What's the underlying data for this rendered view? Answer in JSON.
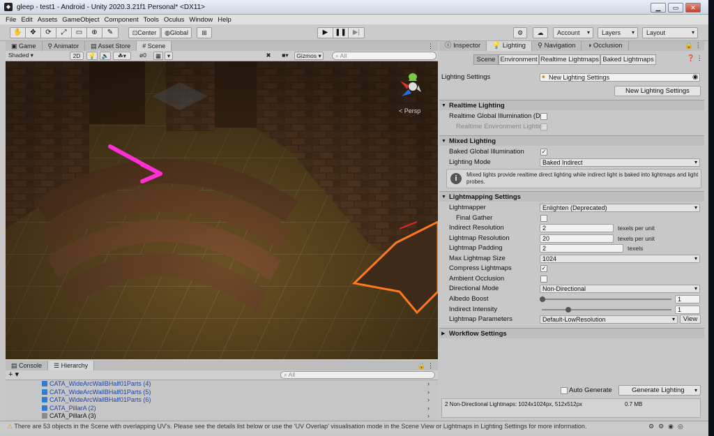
{
  "window": {
    "title": "gleep - test1 - Android - Unity 2020.3.21f1 Personal* <DX11>",
    "controls": [
      "▁",
      "▭",
      "✕"
    ]
  },
  "menu": [
    "File",
    "Edit",
    "Assets",
    "GameObject",
    "Component",
    "Tools",
    "Oculus",
    "Window",
    "Help"
  ],
  "toolbar": {
    "pivot": "Center",
    "space": "Global",
    "account": "Account",
    "layers": "Layers",
    "layout": "Layout"
  },
  "scene_tabs": [
    "Game",
    "Animator",
    "Asset Store",
    "Scene"
  ],
  "scene_bar": {
    "shading": "Shaded",
    "mode2d": "2D",
    "fx_count": "0",
    "gizmos": "Gizmos",
    "search_placeholder": "All"
  },
  "gizmo": {
    "label": "< Persp",
    "axes": [
      "y",
      "x",
      "z"
    ]
  },
  "hierarchy": {
    "tabs": [
      "Console",
      "Hierarchy"
    ],
    "search_placeholder": "All",
    "add": "+",
    "items": [
      "CATA_WideArcWallBHalf01Parts (4)",
      "CATA_WideArcWallBHalf01Parts (5)",
      "CATA_WideArcWallBHalf01Parts (6)",
      "CATA_PillarA (2)",
      "CATA_PillarA (3)"
    ]
  },
  "status": "There are 53 objects in the Scene with overlapping UV's. Please see the details list below or use the 'UV Overlap' visualisation mode in the Scene View or Lightmaps in Lighting Settings for more information.",
  "inspector": {
    "tabs": [
      "Inspector",
      "Lighting",
      "Navigation",
      "Occlusion"
    ],
    "sub_tabs": [
      "Scene",
      "Environment",
      "Realtime Lightmaps",
      "Baked Lightmaps"
    ],
    "lighting_settings_label": "Lighting Settings",
    "lighting_settings_value": "New Lighting Settings",
    "new_settings_button": "New Lighting Settings",
    "realtime": {
      "title": "Realtime Lighting",
      "gi": "Realtime Global Illumination (De",
      "env": "Realtime Environment Lightin"
    },
    "mixed": {
      "title": "Mixed Lighting",
      "baked_gi": "Baked Global Illumination",
      "mode_label": "Lighting Mode",
      "mode_value": "Baked Indirect",
      "info": "Mixed lights provide realtime direct lighting while indirect light is baked into lightmaps and light probes."
    },
    "lightmapping": {
      "title": "Lightmapping Settings",
      "lightmapper_label": "Lightmapper",
      "lightmapper_value": "Enlighten (Deprecated)",
      "final_gather": "Final Gather",
      "indirect_res_label": "Indirect Resolution",
      "indirect_res_value": "2",
      "indirect_res_unit": "texels per unit",
      "lightmap_res_label": "Lightmap Resolution",
      "lightmap_res_value": "20",
      "lightmap_res_unit": "texels per unit",
      "padding_label": "Lightmap Padding",
      "padding_value": "2",
      "padding_unit": "texels",
      "max_size_label": "Max Lightmap Size",
      "max_size_value": "1024",
      "compress_label": "Compress Lightmaps",
      "ao_label": "Ambient Occlusion",
      "dir_label": "Directional Mode",
      "dir_value": "Non-Directional",
      "albedo_label": "Albedo Boost",
      "albedo_value": "1",
      "indirect_int_label": "Indirect Intensity",
      "indirect_int_value": "1",
      "params_label": "Lightmap Parameters",
      "params_value": "Default-LowResolution",
      "view_button": "View"
    },
    "workflow": "Workflow Settings",
    "auto_generate": "Auto Generate",
    "generate_button": "Generate Lighting",
    "footer_info": "2 Non-Directional Lightmaps: 1024x1024px, 512x512px",
    "footer_size": "0.7 MB"
  }
}
